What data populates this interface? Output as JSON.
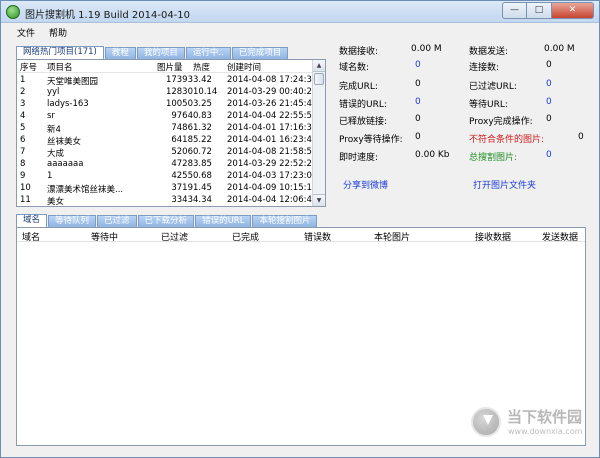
{
  "window": {
    "title": "图片搜割机 1.19 Build 2014-04-10",
    "controls": {
      "minimize": "—",
      "maximize": "□",
      "close": "✕"
    }
  },
  "menu": [
    "文件",
    "帮助"
  ],
  "top_tabs": [
    "网络热门项目(171)",
    "教程",
    "我的项目",
    "运行中..",
    "已完成项目"
  ],
  "project_list": {
    "headers": [
      "序号",
      "项目名",
      "图片量",
      "热度",
      "创建时间"
    ],
    "rows": [
      [
        "1",
        "天堂唯美图园",
        "17393",
        "3.42",
        "2014-04-08 17:24:36"
      ],
      [
        "2",
        "yyl",
        "12830",
        "10.14",
        "2014-03-29 00:40:24"
      ],
      [
        "3",
        "ladys-163",
        "10050",
        "3.25",
        "2014-03-26 21:45:44"
      ],
      [
        "4",
        "sr",
        "9764",
        "0.83",
        "2014-04-04 22:55:53"
      ],
      [
        "5",
        "新4",
        "7486",
        "1.32",
        "2014-04-01 17:16:32"
      ],
      [
        "6",
        "丝袜美女",
        "6418",
        "5.22",
        "2014-04-01 16:23:41"
      ],
      [
        "7",
        "大成",
        "5206",
        "0.72",
        "2014-04-08 21:58:53"
      ],
      [
        "8",
        "aaaaaaa",
        "4728",
        "3.85",
        "2014-03-29 22:52:23"
      ],
      [
        "9",
        "1",
        "4255",
        "0.68",
        "2014-04-03 17:23:04"
      ],
      [
        "10",
        "漂漂美术馆丝袜美...",
        "3719",
        "1.45",
        "2014-04-09 10:15:12"
      ],
      [
        "11",
        "美女",
        "3343",
        "4.34",
        "2014-04-04 12:06:42"
      ]
    ]
  },
  "stats": {
    "received_label": "数据接收:",
    "received_value": "0.00 M",
    "sent_label": "数据发送:",
    "sent_value": "0.00 M",
    "domains_label": "域名数:",
    "domains_value": "0",
    "connections_label": "连接数:",
    "connections_value": "0",
    "done_url_label": "完成URL:",
    "done_url_value": "0",
    "filtered_url_label": "已过滤URL:",
    "filtered_url_value": "0",
    "error_url_label": "错误的URL:",
    "error_url_value": "0",
    "waiting_url_label": "等待URL:",
    "waiting_url_value": "0",
    "released_links_label": "已释放链接:",
    "released_links_value": "0",
    "proxy_done_label": "Proxy完成操作:",
    "proxy_done_value": "0",
    "proxy_wait_label": "Proxy等待操作:",
    "proxy_wait_value": "0",
    "unmatched_label": "不符合条件的图片:",
    "unmatched_value": "0",
    "speed_label": "即时速度:",
    "speed_value": "0.00 Kb",
    "total_label": "总搜割图片:",
    "total_value": "0"
  },
  "links": {
    "share": "分享到微博",
    "open_folder": "打开图片文件夹"
  },
  "bottom_tabs": [
    "域名",
    "等待队列",
    "已过滤",
    "已下载分析",
    "错误的URL",
    "本轮搜割图片"
  ],
  "grid": {
    "headers": [
      "域名",
      "等待中",
      "已过滤",
      "已完成",
      "错误数",
      "本轮图片",
      "接收数据",
      "发送数据"
    ]
  },
  "watermark": {
    "text": "当下软件园",
    "url": "www.downxia.com"
  },
  "colors": {
    "link_blue": "#1b3cd6",
    "warning_red": "#cc1c1c",
    "success_green": "#1f8f20",
    "tab_blue": "#8fb4e3"
  }
}
